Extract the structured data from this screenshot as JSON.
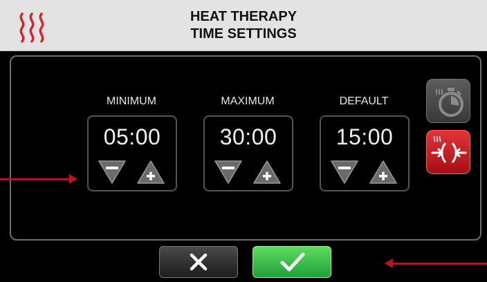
{
  "header": {
    "title_line1": "HEAT THERAPY",
    "title_line2": "TIME SETTINGS",
    "logo_icon": "heat-waves-icon",
    "logo_color": "#d8232a"
  },
  "settings": [
    {
      "label": "MINIMUM",
      "value": "05:00"
    },
    {
      "label": "MAXIMUM",
      "value": "30:00"
    },
    {
      "label": "DEFAULT",
      "value": "15:00"
    }
  ],
  "icons": {
    "decrease": "minus-triangle-icon",
    "increase": "plus-triangle-icon",
    "timer": "stopwatch-icon",
    "compression": "heat-compression-icon",
    "cancel": "x-icon",
    "confirm": "check-icon"
  },
  "colors": {
    "accent_red": "#d8232a",
    "confirm_green": "#3cc63c",
    "panel_bg": "#000000"
  }
}
